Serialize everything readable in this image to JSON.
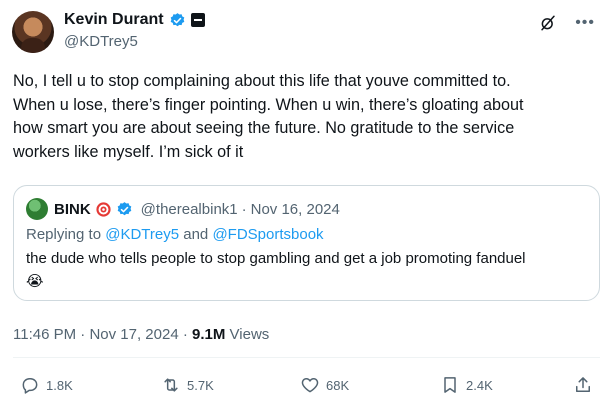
{
  "author": {
    "name": "Kevin Durant",
    "handle": "@KDTrey5"
  },
  "tweet": {
    "text": "No, I tell u to stop complaining about this life that youve committed to.\nWhen u lose, there’s finger pointing. When u win, there’s gloating about\nhow smart you are about seeing the future. No gratitude to the service\nworkers like myself. I’m sick of it"
  },
  "quote": {
    "name": "BINK",
    "handle": "@therealbink1",
    "separator": "·",
    "date": "Nov 16, 2024",
    "replying_prefix": "Replying to",
    "reply_user1": "@KDTrey5",
    "reply_and": "and",
    "reply_user2": "@FDSportsbook",
    "text": "the dude who tells people to stop gambling and get a job promoting fanduel",
    "emoji": "😭"
  },
  "meta": {
    "time": "11:46 PM",
    "separator": "·",
    "date": "Nov 17, 2024",
    "views_count": "9.1M",
    "views_label": "Views"
  },
  "actions": {
    "replies": "1.8K",
    "reposts": "5.7K",
    "likes": "68K",
    "bookmarks": "2.4K"
  },
  "colors": {
    "accent": "#1d9bf0",
    "secondary_text": "#536471",
    "border": "#cfd9de"
  }
}
